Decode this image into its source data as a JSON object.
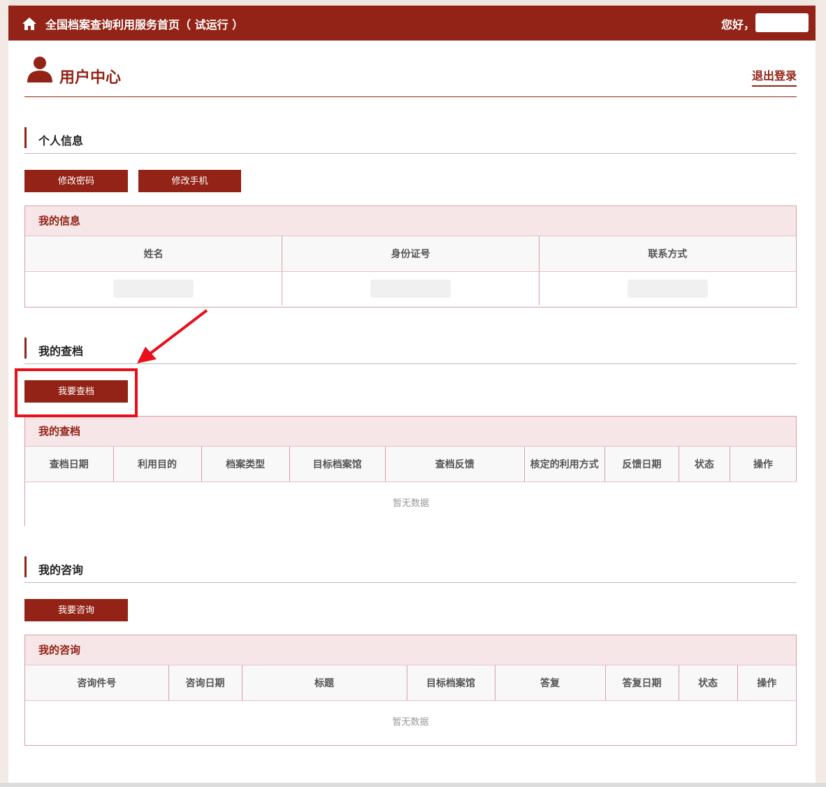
{
  "topbar": {
    "home_icon": "home-icon",
    "site_title": "全国档案查询利用服务首页（ 试运行 ）",
    "greeting": "您好，"
  },
  "user_center": {
    "title": "用户中心",
    "user_icon": "user-icon",
    "logout": "退出登录"
  },
  "personal_info": {
    "section_title": "个人信息",
    "change_password": "修改密码",
    "change_phone": "修改手机",
    "card_title": "我的信息",
    "columns": [
      "姓名",
      "身份证号",
      "联系方式"
    ]
  },
  "my_archive": {
    "section_title": "我的查档",
    "request_button": "我要查档",
    "card_title": "我的查档",
    "columns": [
      "查档日期",
      "利用目的",
      "档案类型",
      "目标档案馆",
      "查档反馈",
      "核定的利用方式",
      "反馈日期",
      "状态",
      "操作"
    ],
    "empty_text": "暂无数据"
  },
  "my_consult": {
    "section_title": "我的咨询",
    "request_button": "我要咨询",
    "card_title": "我的咨询",
    "columns": [
      "咨询件号",
      "咨询日期",
      "标题",
      "目标档案馆",
      "答复",
      "答复日期",
      "状态",
      "操作"
    ],
    "empty_text": "暂无数据"
  },
  "colors": {
    "brand": "#922316",
    "highlight": "#e8101b",
    "card_head_bg": "#f7e6e8"
  }
}
